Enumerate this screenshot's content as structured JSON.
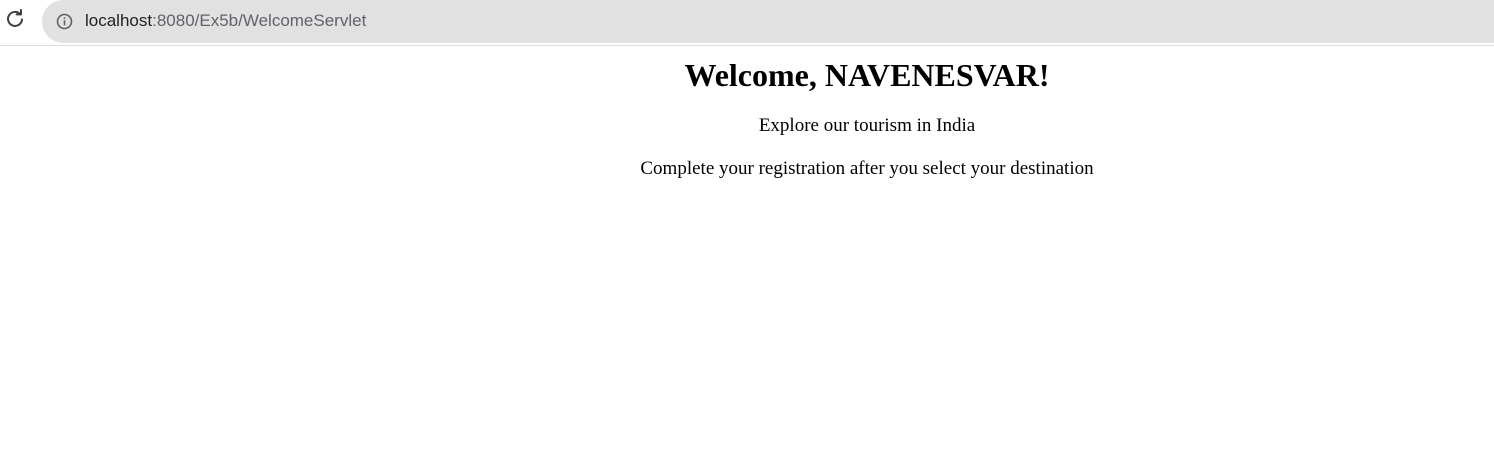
{
  "browser": {
    "url_host": "localhost",
    "url_rest": ":8080/Ex5b/WelcomeServlet",
    "reload_icon": "reload-icon",
    "info_icon": "info-icon"
  },
  "page": {
    "heading": "Welcome, NAVENESVAR!",
    "line1": "Explore our tourism in India",
    "line2": "Complete your registration after you select your destination"
  },
  "colors": {
    "omnibox_bg": "#e1e1e1",
    "url_host": "#202124",
    "url_rest": "#5f6368",
    "text": "#000000"
  }
}
